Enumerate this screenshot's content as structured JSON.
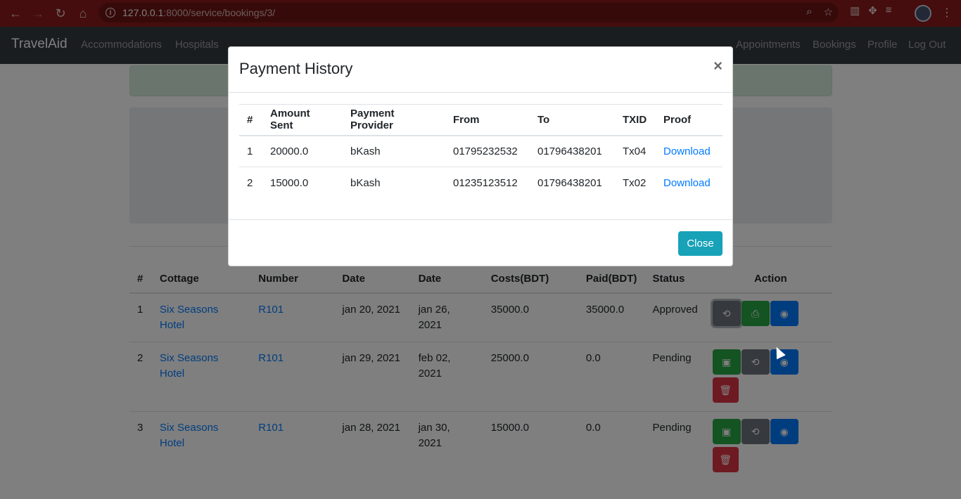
{
  "browser": {
    "url_host": "127.0.0.1",
    "url_path": ":8000/service/bookings/3/"
  },
  "navbar": {
    "brand": "TravelAid",
    "left_links": [
      "Accommodations",
      "Hospitals"
    ],
    "right_links": [
      "Appointments",
      "Bookings",
      "Profile",
      "Log Out"
    ]
  },
  "bookings": {
    "headers": [
      "#",
      "Cottage",
      "Number",
      "Date",
      "Date",
      "Costs(BDT)",
      "Paid(BDT)",
      "Status",
      "Action"
    ],
    "rows": [
      {
        "num": "1",
        "cottage": "Six Seasons Hotel",
        "number": "R101",
        "checkin": "jan 20, 2021",
        "checkout": "jan 26, 2021",
        "cost": "35000.0",
        "paid": "35000.0",
        "status": "Approved"
      },
      {
        "num": "2",
        "cottage": "Six Seasons Hotel",
        "number": "R101",
        "checkin": "jan 29, 2021",
        "checkout": "feb 02, 2021",
        "cost": "25000.0",
        "paid": "0.0",
        "status": "Pending"
      },
      {
        "num": "3",
        "cottage": "Six Seasons Hotel",
        "number": "R101",
        "checkin": "jan 28, 2021",
        "checkout": "jan 30, 2021",
        "cost": "15000.0",
        "paid": "0.0",
        "status": "Pending"
      }
    ]
  },
  "modal": {
    "title": "Payment History",
    "close_symbol": "×",
    "headers": [
      "#",
      "Amount Sent",
      "Payment Provider",
      "From",
      "To",
      "TXID",
      "Proof"
    ],
    "rows": [
      {
        "num": "1",
        "amount": "20000.0",
        "provider": "bKash",
        "from": "01795232532",
        "to": "01796438201",
        "txid": "Tx04",
        "proof": "Download"
      },
      {
        "num": "2",
        "amount": "15000.0",
        "provider": "bKash",
        "from": "01235123512",
        "to": "01796438201",
        "txid": "Tx02",
        "proof": "Download"
      }
    ],
    "close_button": "Close"
  },
  "colors": {
    "chrome": "#8b1a1a",
    "navbar": "#343a40",
    "primary": "#007bff",
    "success": "#28a745",
    "danger": "#dc3545",
    "info": "#17a2b8"
  }
}
